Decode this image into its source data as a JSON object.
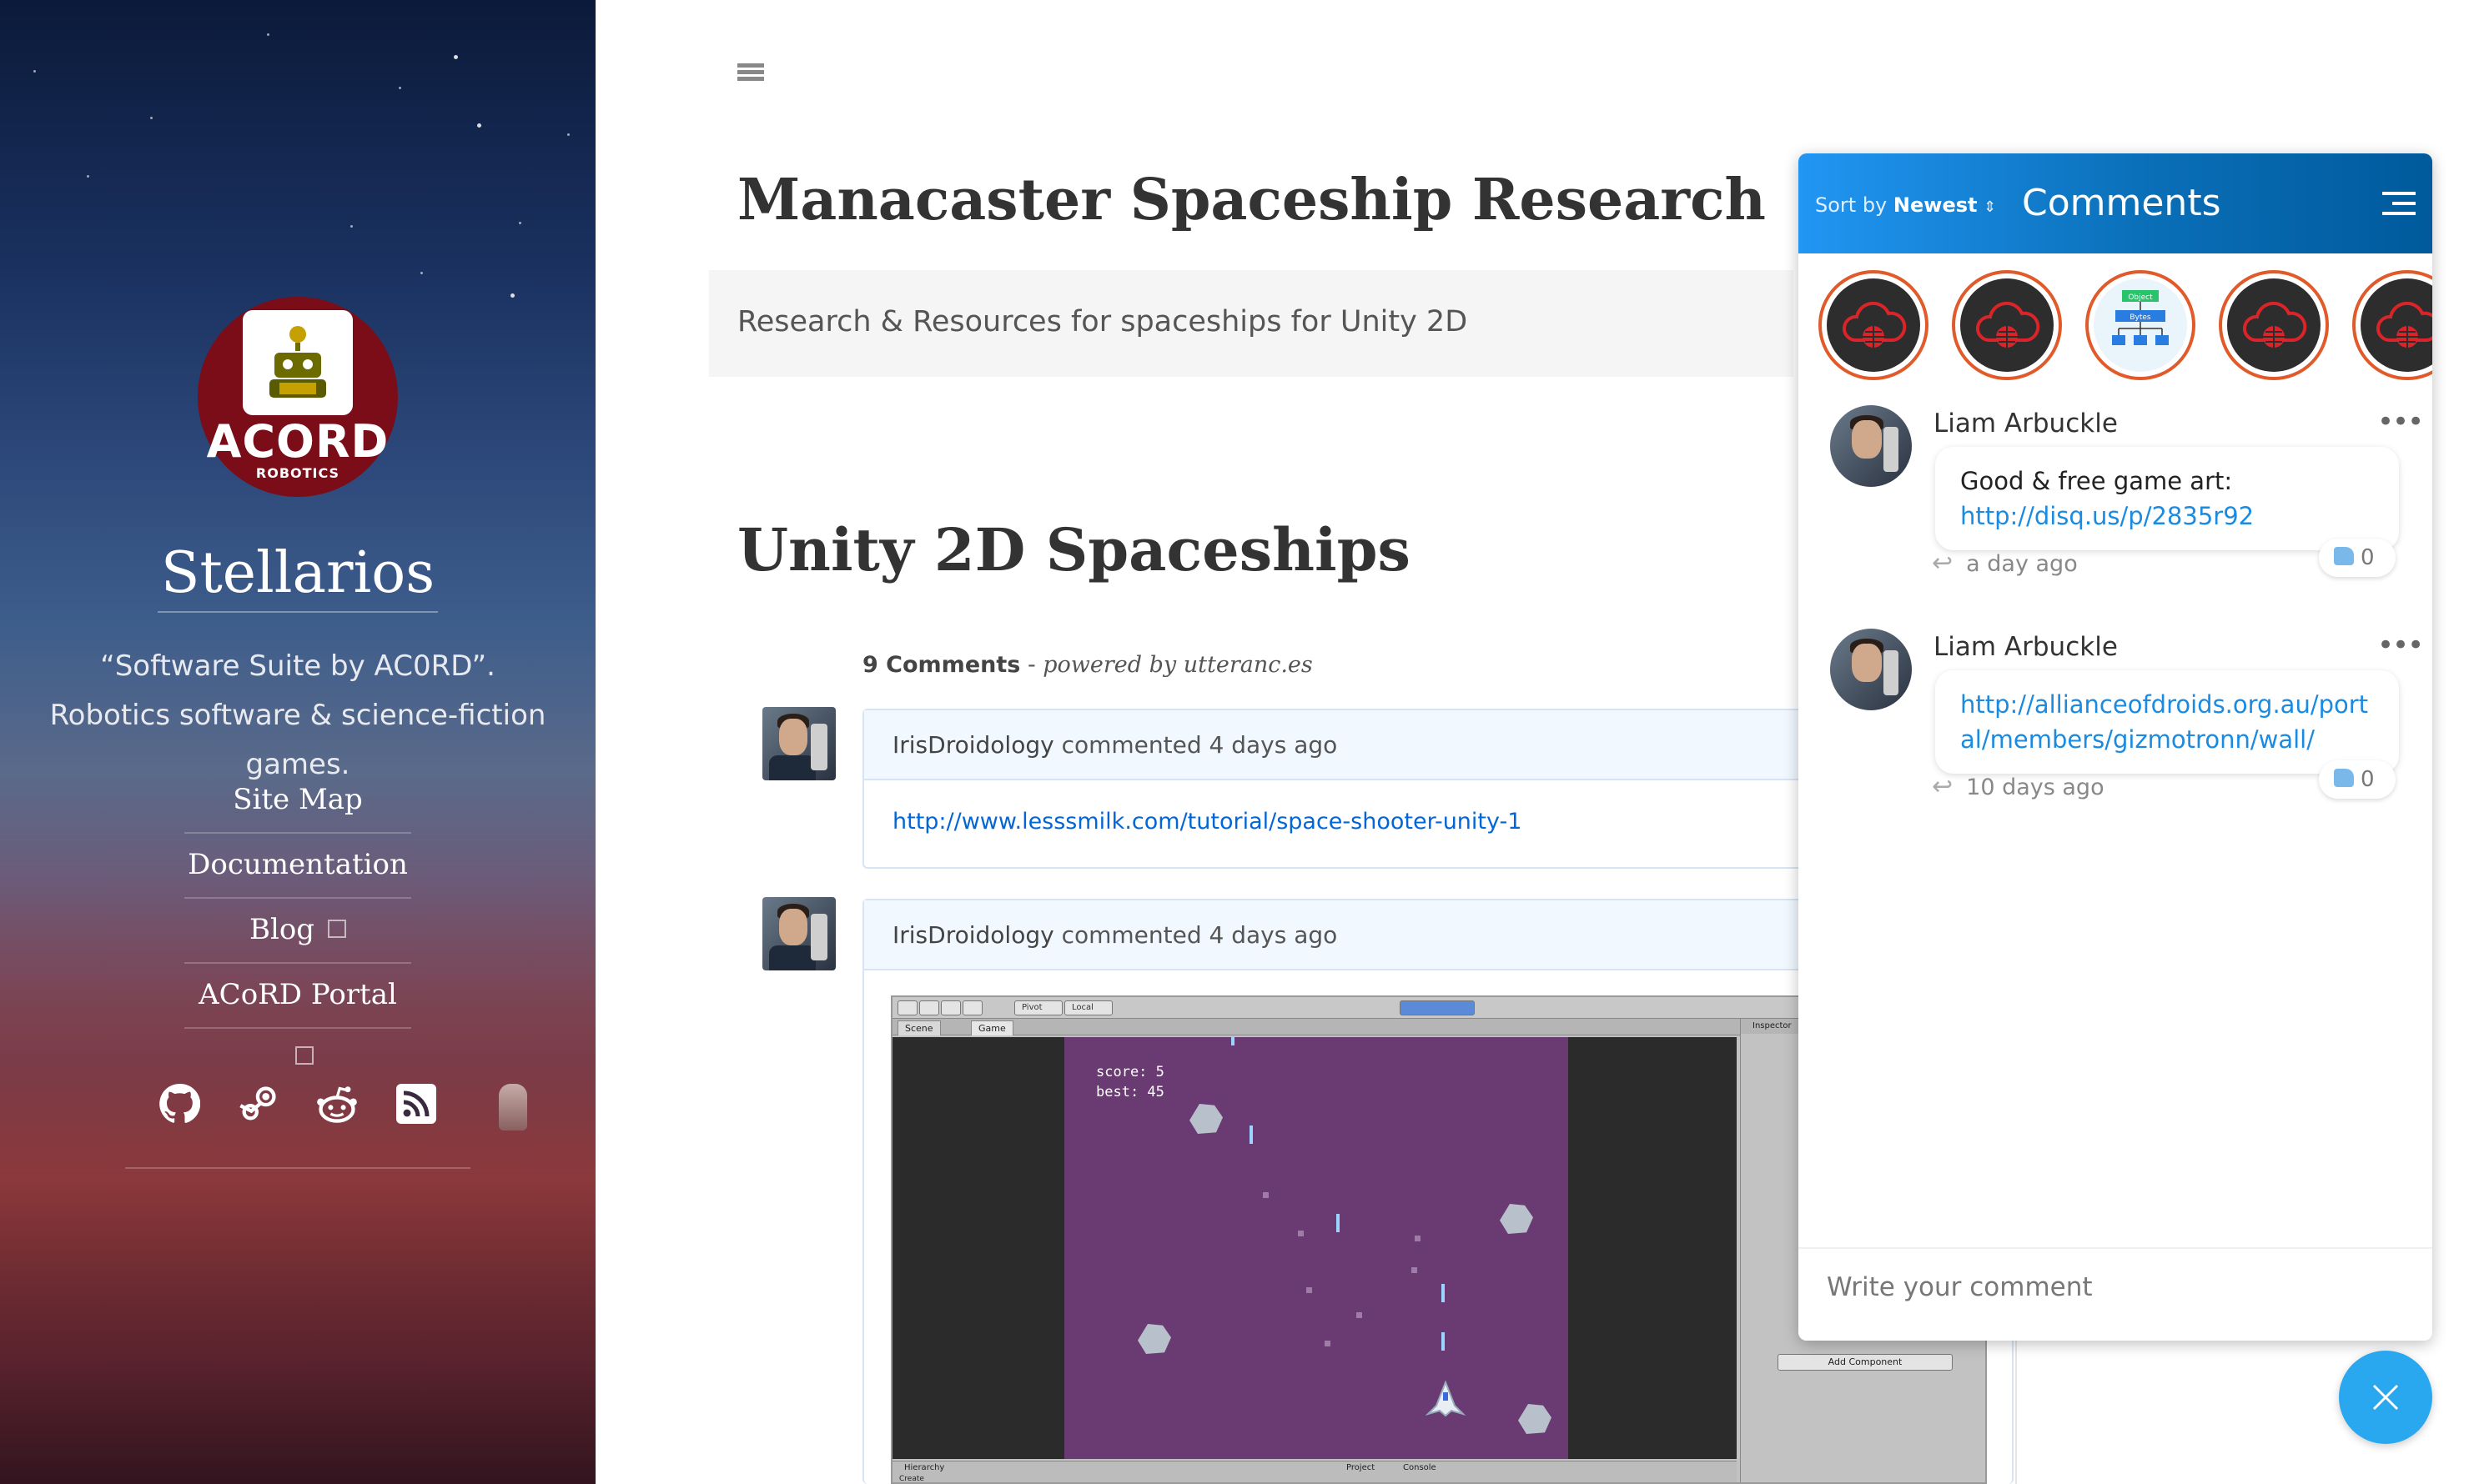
{
  "sidebar": {
    "logo_text": "ACORD",
    "logo_subtext": "ROBOTICS",
    "site_title": "Stellarios",
    "description": "“Software Suite by AC0RD”. Robotics software & science-fiction games.",
    "nav": [
      {
        "label": "Site Map",
        "external": false
      },
      {
        "label": "Documentation",
        "external": false
      },
      {
        "label": "Blog",
        "external": true
      },
      {
        "label": "ACoRD Portal",
        "external": true
      }
    ],
    "social": [
      "github-icon",
      "steam-icon",
      "reddit-icon",
      "rss-icon"
    ]
  },
  "main": {
    "page_title": "Manacaster Spaceship Research",
    "subtitle": "Research & Resources for spaceships for Unity 2D",
    "section_title": "Unity 2D Spaceships",
    "comments_count": "9 Comments",
    "powered_by": "powered by utteranc.es",
    "comments": [
      {
        "author": "IrisDroidology",
        "meta": "commented 4 days ago",
        "body_link": "http://www.lesssmilk.com/tutorial/space-shooter-unity-1"
      },
      {
        "author": "IrisDroidology",
        "meta": "commented 4 days ago",
        "game": {
          "score": "score: 5",
          "best": "best: 45",
          "tab_scene": "Scene",
          "tab_game": "Game",
          "pivot": "Pivot",
          "local": "Local",
          "inspector": "Inspector",
          "hierarchy": "Hierarchy",
          "project": "Project",
          "console": "Console",
          "create": "Create",
          "add_component": "Add Component"
        }
      }
    ]
  },
  "disqus": {
    "sort_label": "Sort by",
    "sort_value": "Newest",
    "title": "Comments",
    "posts": [
      {
        "author": "Liam Arbuckle",
        "text": "Good & free game art:",
        "link": "http://disq.us/p/2835r92",
        "likes": "0",
        "time": "a day ago"
      },
      {
        "author": "Liam Arbuckle",
        "text": "",
        "link": "http://allianceofdroids.org.au/portal/members/gizmotronn/wall/",
        "likes": "0",
        "time": "10 days ago"
      }
    ],
    "input_placeholder": "Write your comment",
    "more_glyph": "•••",
    "reply_glyph": "↩",
    "object_label": "Object",
    "bytes_label": "Bytes"
  },
  "colors": {
    "accent": "#2196f3",
    "logo_bg": "#7a0d18",
    "link": "#0366d6",
    "avatar_ring": "#e05a2a"
  }
}
